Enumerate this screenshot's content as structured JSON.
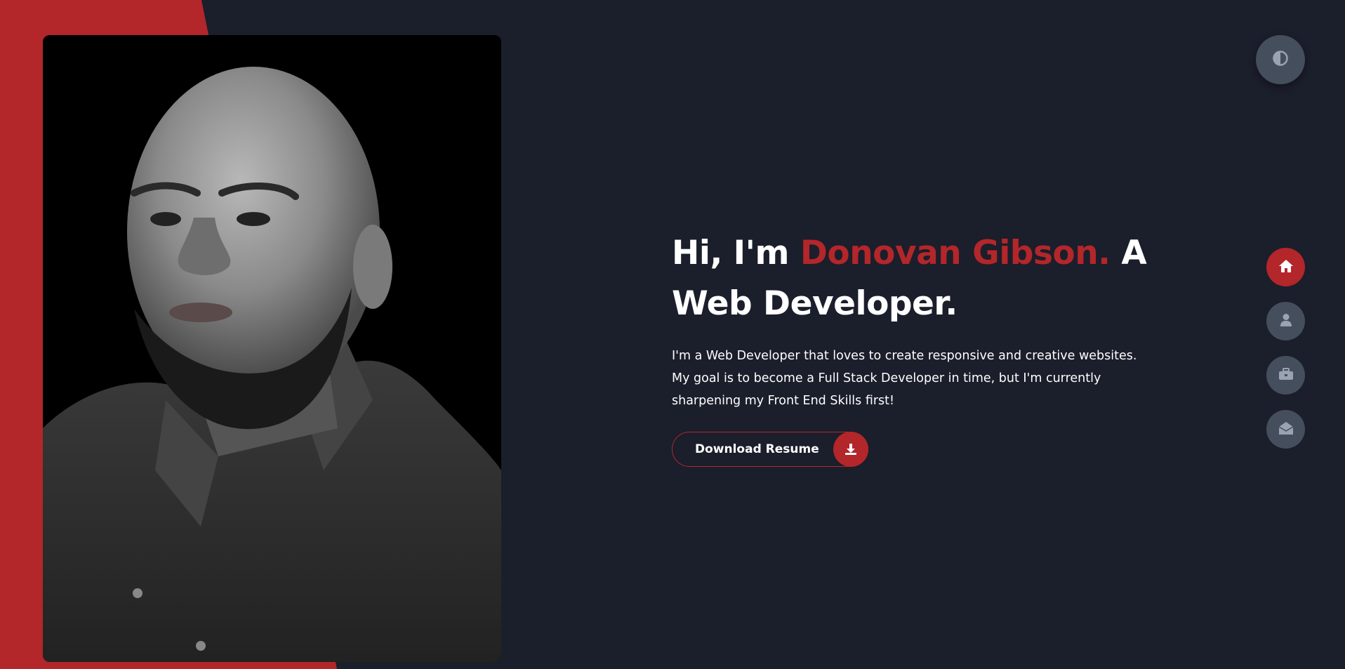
{
  "colors": {
    "background": "#1b1e2b",
    "accent": "#b3262a",
    "button_gray": "#454e5c",
    "icon_gray": "#9aa3b2",
    "text": "#ffffff"
  },
  "hero": {
    "greeting": "Hi, I'm ",
    "name": "Donovan Gibson.",
    "role_line1": " A",
    "role_line2": "Web Developer.",
    "description": "I'm a Web Developer that loves to create responsive and creative websites. My goal is to become a Full Stack Developer in time, but I'm currently sharpening my Front End Skills first!"
  },
  "download_button": {
    "label": "Download Resume",
    "icon": "download-icon"
  },
  "theme_toggle": {
    "icon": "contrast-icon"
  },
  "nav": {
    "items": [
      {
        "icon": "home-icon",
        "active": true
      },
      {
        "icon": "user-icon",
        "active": false
      },
      {
        "icon": "briefcase-icon",
        "active": false
      },
      {
        "icon": "envelope-open-icon",
        "active": false
      }
    ]
  },
  "portrait": {
    "icon": "profile-photo"
  }
}
